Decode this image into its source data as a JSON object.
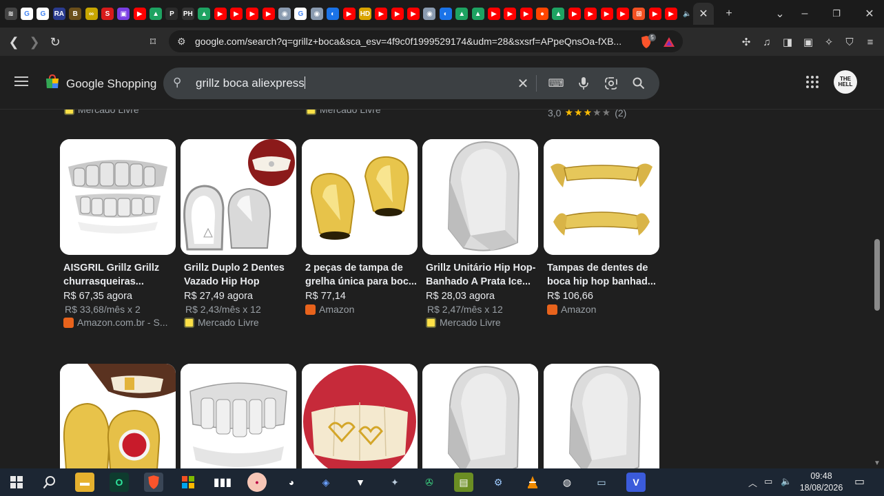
{
  "browser": {
    "active_tab_close": "✕",
    "new_tab": "+",
    "tab_icons": [
      {
        "icon": "brave-stack-icon",
        "color": "#444444",
        "glyph": "≋"
      },
      {
        "icon": "google-icon",
        "color": "#ffffff",
        "glyph": "G"
      },
      {
        "icon": "google-icon",
        "color": "#ffffff",
        "glyph": "G"
      },
      {
        "icon": "ra-icon",
        "color": "#2a3b8f",
        "glyph": "RA"
      },
      {
        "icon": "b-icon",
        "color": "#6b4f1a",
        "glyph": "B"
      },
      {
        "icon": "gamepad-icon",
        "color": "#c7a600",
        "glyph": "∞"
      },
      {
        "icon": "flag-icon",
        "color": "#d81b1b",
        "glyph": "S"
      },
      {
        "icon": "twitch-icon",
        "color": "#7b3fe4",
        "glyph": "▣"
      },
      {
        "icon": "youtube-icon",
        "color": "#ff0000",
        "glyph": "▶"
      },
      {
        "icon": "drive-icon",
        "color": "#1ea362",
        "glyph": "▲"
      },
      {
        "icon": "p-icon",
        "color": "#2b2b2b",
        "glyph": "P"
      },
      {
        "icon": "pwn-icon",
        "color": "#333333",
        "glyph": "PH"
      },
      {
        "icon": "drive-icon",
        "color": "#1ea362",
        "glyph": "▲"
      },
      {
        "icon": "youtube-icon",
        "color": "#ff0000",
        "glyph": "▶"
      },
      {
        "icon": "youtube-icon",
        "color": "#ff0000",
        "glyph": "▶"
      },
      {
        "icon": "youtube-icon",
        "color": "#ff0000",
        "glyph": "▶"
      },
      {
        "icon": "youtube-icon",
        "color": "#ff0000",
        "glyph": "▶"
      },
      {
        "icon": "mask-icon",
        "color": "#8a9bb0",
        "glyph": "◉"
      },
      {
        "icon": "google-icon",
        "color": "#ffffff",
        "glyph": "G"
      },
      {
        "icon": "mask-icon",
        "color": "#8a9bb0",
        "glyph": "◉"
      },
      {
        "icon": "toggle-icon",
        "color": "#1a73e8",
        "glyph": "◐"
      },
      {
        "icon": "youtube-icon",
        "color": "#ff0000",
        "glyph": "▶"
      },
      {
        "icon": "hd-icon",
        "color": "#d9a400",
        "glyph": "HD"
      },
      {
        "icon": "youtube-icon",
        "color": "#ff0000",
        "glyph": "▶"
      },
      {
        "icon": "youtube-icon",
        "color": "#ff0000",
        "glyph": "▶"
      },
      {
        "icon": "youtube-icon",
        "color": "#ff0000",
        "glyph": "▶"
      },
      {
        "icon": "mask-icon",
        "color": "#8a9bb0",
        "glyph": "◉"
      },
      {
        "icon": "toggle-icon",
        "color": "#1a73e8",
        "glyph": "◐"
      },
      {
        "icon": "drive-icon",
        "color": "#1ea362",
        "glyph": "▲"
      },
      {
        "icon": "drive-icon",
        "color": "#1ea362",
        "glyph": "▲"
      },
      {
        "icon": "youtube-icon",
        "color": "#ff0000",
        "glyph": "▶"
      },
      {
        "icon": "youtube-icon",
        "color": "#ff0000",
        "glyph": "▶"
      },
      {
        "icon": "youtube-icon",
        "color": "#ff0000",
        "glyph": "▶"
      },
      {
        "icon": "reddit-icon",
        "color": "#ff4500",
        "glyph": "●"
      },
      {
        "icon": "drive-icon",
        "color": "#1ea362",
        "glyph": "▲"
      },
      {
        "icon": "youtube-icon",
        "color": "#ff0000",
        "glyph": "▶"
      },
      {
        "icon": "youtube-icon",
        "color": "#ff0000",
        "glyph": "▶"
      },
      {
        "icon": "youtube-icon",
        "color": "#ff0000",
        "glyph": "▶"
      },
      {
        "icon": "youtube-icon",
        "color": "#ff0000",
        "glyph": "▶"
      },
      {
        "icon": "microsoft-icon",
        "color": "#f25022",
        "glyph": "⊞"
      },
      {
        "icon": "youtube-icon",
        "color": "#ff0000",
        "glyph": "▶"
      },
      {
        "icon": "youtube-icon",
        "color": "#ff0000",
        "glyph": "▶"
      },
      {
        "icon": "speaker-icon",
        "color": "#1b1b1b",
        "glyph": "🔈"
      }
    ],
    "url": "google.com/search?q=grillz+boca&sca_esv=4f9c0f1999529174&udm=28&sxsrf=APpeQnsOa-fXB...",
    "shield_badge": "5"
  },
  "google": {
    "brand": "Google Shopping",
    "search_value": "grillz boca aliexpress",
    "avatar_text": "THE HELL"
  },
  "previous_row": {
    "store_1": "Mercado Livre",
    "store_2": "Mercado Livre",
    "rating_value": "3,0",
    "rating_stars": 3,
    "rating_count": "(2)"
  },
  "products_row1": [
    {
      "title": "AISGRIL Grillz Grillz churrasqueiras...",
      "price": "R$ 67,35 agora",
      "installment": "R$ 33,68/mês x 2",
      "store": "Amazon.com.br - S...",
      "store_type": "amazon"
    },
    {
      "title": "Grillz Duplo 2 Dentes Vazado Hip Hop",
      "price": "R$ 27,49 agora",
      "installment": "R$ 2,43/mês x 12",
      "store": "Mercado Livre",
      "store_type": "ml"
    },
    {
      "title": "2 peças de tampa de grelha única para boc...",
      "price": "R$ 77,14",
      "installment": "",
      "store": "Amazon",
      "store_type": "amazon"
    },
    {
      "title": "Grillz Unitário Hip Hop- Banhado A Prata Ice...",
      "price": "R$ 28,03 agora",
      "installment": "R$ 2,47/mês x 12",
      "store": "Mercado Livre",
      "store_type": "ml"
    },
    {
      "title": "Tampas de dentes de boca hip hop banhad...",
      "price": "R$ 106,66",
      "installment": "",
      "store": "Amazon",
      "store_type": "amazon"
    }
  ],
  "taskbar": {
    "time": "09:48",
    "date": "18/08/2026",
    "colors": {
      "bg": "#1c2633",
      "accent": "#fb542b"
    }
  }
}
